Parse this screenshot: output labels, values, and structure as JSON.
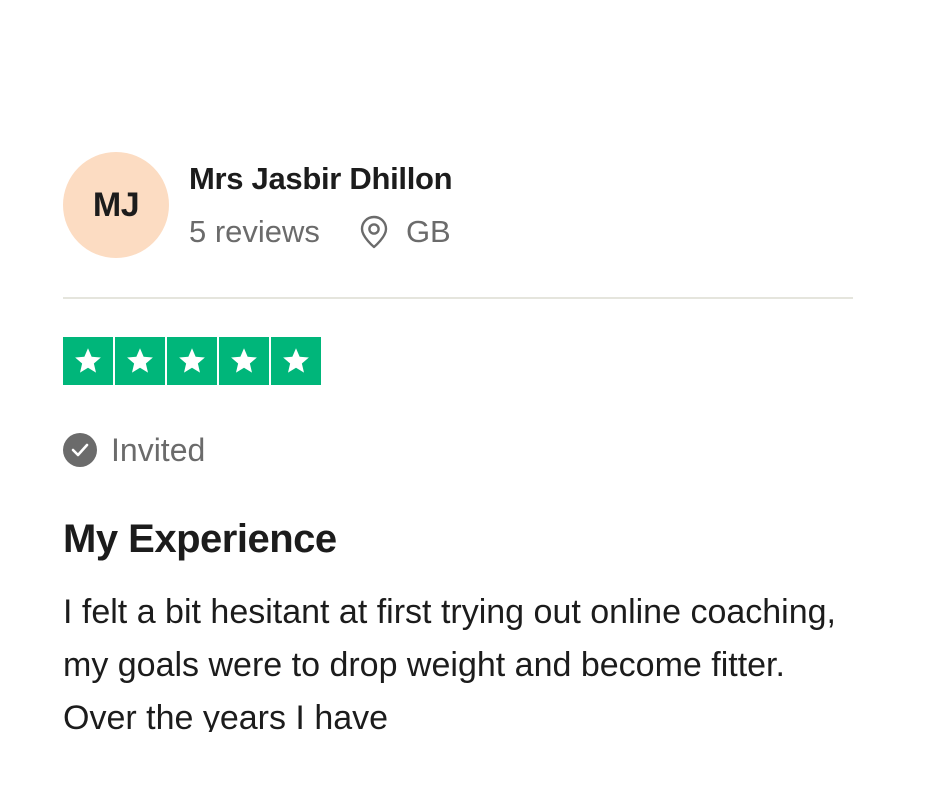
{
  "reviewer": {
    "initials": "MJ",
    "name": "Mrs Jasbir Dhillon",
    "reviews_count": "5 reviews",
    "location_icon": "location-pin-icon",
    "country": "GB",
    "avatar_color": "#fcdcc2"
  },
  "rating": {
    "stars": 5,
    "max_stars": 5,
    "star_icon": "star-icon",
    "star_color": "#00b67a"
  },
  "verification": {
    "icon": "check-circle-icon",
    "label": "Invited"
  },
  "review": {
    "title": "My Experience",
    "body": "I felt a bit hesitant at first trying out online coaching, my goals were to drop weight and become fitter. Over the years I have"
  }
}
